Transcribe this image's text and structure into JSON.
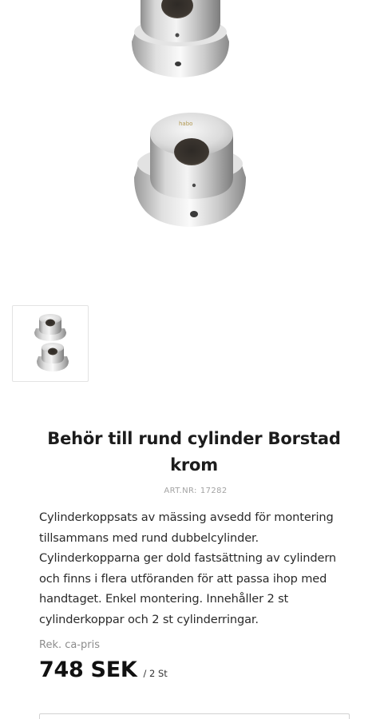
{
  "product": {
    "title": "Behör till rund cylinder Borstad krom",
    "artnr_label": "ART.NR:",
    "artnr_value": "17282",
    "description": "Cylinderkoppsats av mässing avsedd för montering tillsammans med rund dubbelcylinder. Cylinderkopparna ger dold fastsättning av cylindern och finns i flera utföranden för att passa ihop med handtaget. Enkel montering. Innehåller 2 st cylinderkoppar och 2 st cylinderringar.",
    "price_label": "Rek. ca-pris",
    "price": "748 SEK",
    "unit": "/ 2 St"
  },
  "gallery": {
    "logo_text": "habo"
  },
  "icons": {
    "main_image": "product-photo",
    "thumbnail": "product-thumbnail"
  }
}
